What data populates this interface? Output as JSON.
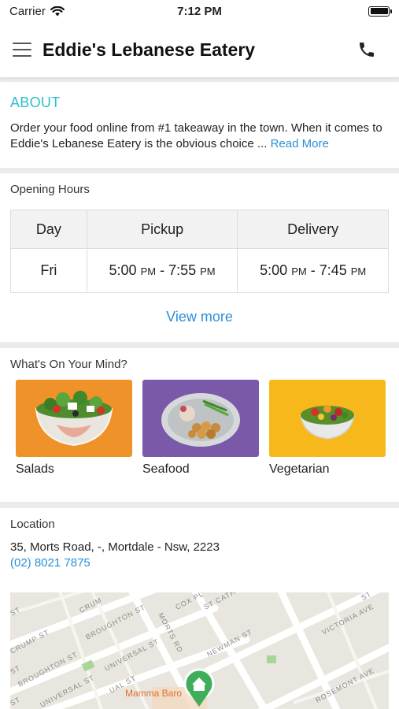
{
  "status": {
    "carrier": "Carrier",
    "time": "7:12 PM"
  },
  "header": {
    "title": "Eddie's Lebanese Eatery"
  },
  "about": {
    "title": "ABOUT",
    "text": "Order your food online from #1 takeaway in the town. When it comes to Eddie's Lebanese Eatery is the obvious choice ...",
    "read_more": "Read More"
  },
  "hours": {
    "label": "Opening Hours",
    "columns": [
      "Day",
      "Pickup",
      "Delivery"
    ],
    "rows": [
      {
        "day": "Fri",
        "pickup_start": "5:00",
        "pickup_start_ampm": "PM",
        "pickup_end": "7:55",
        "pickup_end_ampm": "PM",
        "delivery_start": "5:00",
        "delivery_start_ampm": "PM",
        "delivery_end": "7:45",
        "delivery_end_ampm": "PM"
      }
    ],
    "view_more": "View more"
  },
  "mind": {
    "label": "What's On Your Mind?",
    "categories": [
      {
        "label": "Salads",
        "color": "#f0922a"
      },
      {
        "label": "Seafood",
        "color": "#7a5aa8"
      },
      {
        "label": "Vegetarian",
        "color": "#f7b81c"
      }
    ]
  },
  "location": {
    "label": "Location",
    "address": "35, Morts Road, -, Mortdale - Nsw, 2223",
    "phone": "(02) 8021 7875",
    "map": {
      "streets": [
        "CRUMP ST",
        "BROUGHTON ST",
        "UNIVERSAL ST",
        "MORTS RD",
        "COX PL",
        "ST CATH",
        "NEWMAN ST",
        "VICTORIA AVE",
        "ROSEMONT AVE",
        "BROUGHTON ST",
        "UNIVERSAL ST",
        "CRUM",
        "UAL ST",
        "ST",
        "ST",
        "ST",
        "ST"
      ],
      "place": "Mamma Baro"
    }
  },
  "colors": {
    "accent": "#2dbfc7",
    "link": "#2b8fd6",
    "pin": "#3fae5a"
  }
}
